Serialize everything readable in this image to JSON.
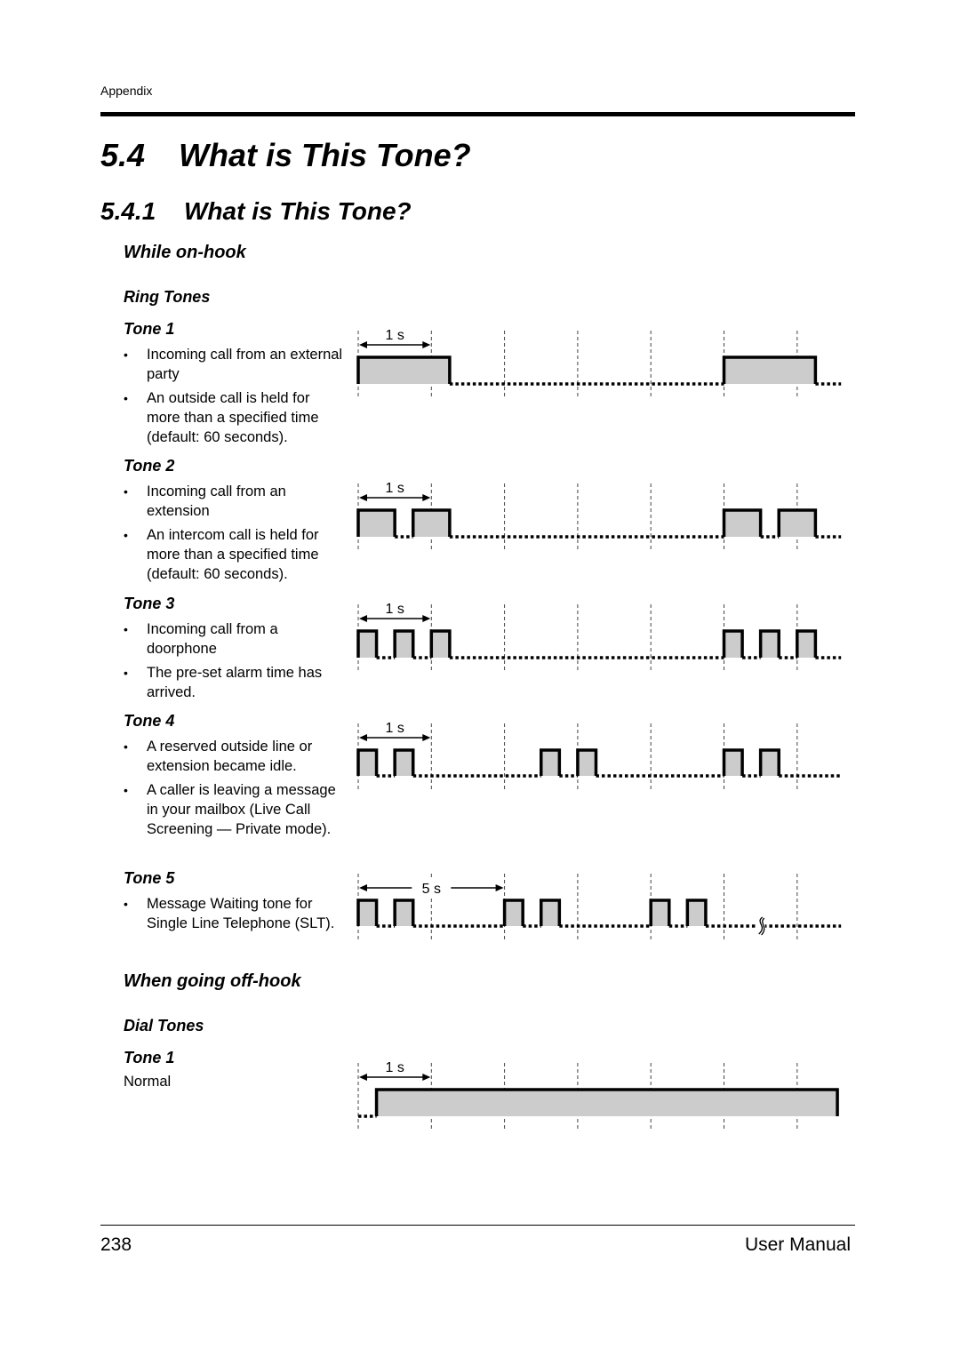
{
  "header": {
    "running_head": "Appendix"
  },
  "section": {
    "number": "5.4",
    "title": "What is This Tone?"
  },
  "subsection": {
    "number": "5.4.1",
    "title": "What is This Tone?"
  },
  "on_hook": {
    "heading": "While on-hook",
    "group_heading": "Ring Tones",
    "tones": [
      {
        "label": "Tone 1",
        "bullets": [
          "Incoming call from an external party",
          "An outside call is held for more than a specified time (default: 60 seconds)."
        ],
        "scale_label": "1 s"
      },
      {
        "label": "Tone 2",
        "bullets": [
          "Incoming call from an extension",
          "An intercom call is held for more than a specified time (default: 60 seconds)."
        ],
        "scale_label": "1 s"
      },
      {
        "label": "Tone 3",
        "bullets": [
          "Incoming call from a doorphone",
          "The pre-set alarm time has arrived."
        ],
        "scale_label": "1 s"
      },
      {
        "label": "Tone 4",
        "bullets": [
          "A reserved outside line or extension became idle.",
          "A caller is leaving a message in your mailbox (Live Call Screening — Private mode)."
        ],
        "scale_label": "1 s"
      },
      {
        "label": "Tone 5",
        "bullets": [
          "Message Waiting tone for Single Line Telephone (SLT)."
        ],
        "scale_label": "5 s"
      }
    ]
  },
  "off_hook": {
    "heading": "When going off-hook",
    "group_heading": "Dial Tones",
    "tones": [
      {
        "label": "Tone 1",
        "description": "Normal",
        "scale_label": "1 s"
      }
    ]
  },
  "footer": {
    "page_number": "238",
    "document_title": "User Manual"
  },
  "chart_data": [
    {
      "type": "timing",
      "name": "Ring Tone 1",
      "unit": "s",
      "scale_label": "1 s",
      "scale_span_s": 1,
      "grid_step_s": 1,
      "x_range": [
        0,
        6.6
      ],
      "on_intervals": [
        [
          0,
          1.25
        ],
        [
          5.0,
          6.25
        ]
      ],
      "break_mark_at": null
    },
    {
      "type": "timing",
      "name": "Ring Tone 2",
      "unit": "s",
      "scale_label": "1 s",
      "scale_span_s": 1,
      "grid_step_s": 1,
      "x_range": [
        0,
        6.6
      ],
      "on_intervals": [
        [
          0,
          0.5
        ],
        [
          0.75,
          1.25
        ],
        [
          5.0,
          5.5
        ],
        [
          5.75,
          6.25
        ]
      ],
      "break_mark_at": null
    },
    {
      "type": "timing",
      "name": "Ring Tone 3",
      "unit": "s",
      "scale_label": "1 s",
      "scale_span_s": 1,
      "grid_step_s": 1,
      "x_range": [
        0,
        6.6
      ],
      "on_intervals": [
        [
          0,
          0.25
        ],
        [
          0.5,
          0.75
        ],
        [
          1.0,
          1.25
        ],
        [
          5.0,
          5.25
        ],
        [
          5.5,
          5.75
        ],
        [
          6.0,
          6.25
        ]
      ],
      "break_mark_at": null
    },
    {
      "type": "timing",
      "name": "Ring Tone 4",
      "unit": "s",
      "scale_label": "1 s",
      "scale_span_s": 1,
      "grid_step_s": 1,
      "x_range": [
        0,
        6.6
      ],
      "on_intervals": [
        [
          0,
          0.25
        ],
        [
          0.5,
          0.75
        ],
        [
          2.5,
          2.75
        ],
        [
          3.0,
          3.25
        ],
        [
          5.0,
          5.25
        ],
        [
          5.5,
          5.75
        ]
      ],
      "break_mark_at": null
    },
    {
      "type": "timing",
      "name": "Ring Tone 5",
      "unit": "s",
      "scale_label": "5 s",
      "scale_span_s": 2,
      "grid_step_s": 1,
      "x_range": [
        0,
        6.6
      ],
      "on_intervals": [
        [
          0,
          0.25
        ],
        [
          0.5,
          0.75
        ],
        [
          2.0,
          2.25
        ],
        [
          2.5,
          2.75
        ],
        [
          4.0,
          4.25
        ],
        [
          4.5,
          4.75
        ]
      ],
      "break_mark_at": 5.5
    },
    {
      "type": "timing",
      "name": "Dial Tone 1",
      "unit": "s",
      "scale_label": "1 s",
      "scale_span_s": 1,
      "grid_step_s": 1,
      "x_range": [
        0,
        6.55
      ],
      "on_intervals": [
        [
          0.25,
          6.55
        ]
      ],
      "break_mark_at": null
    }
  ]
}
